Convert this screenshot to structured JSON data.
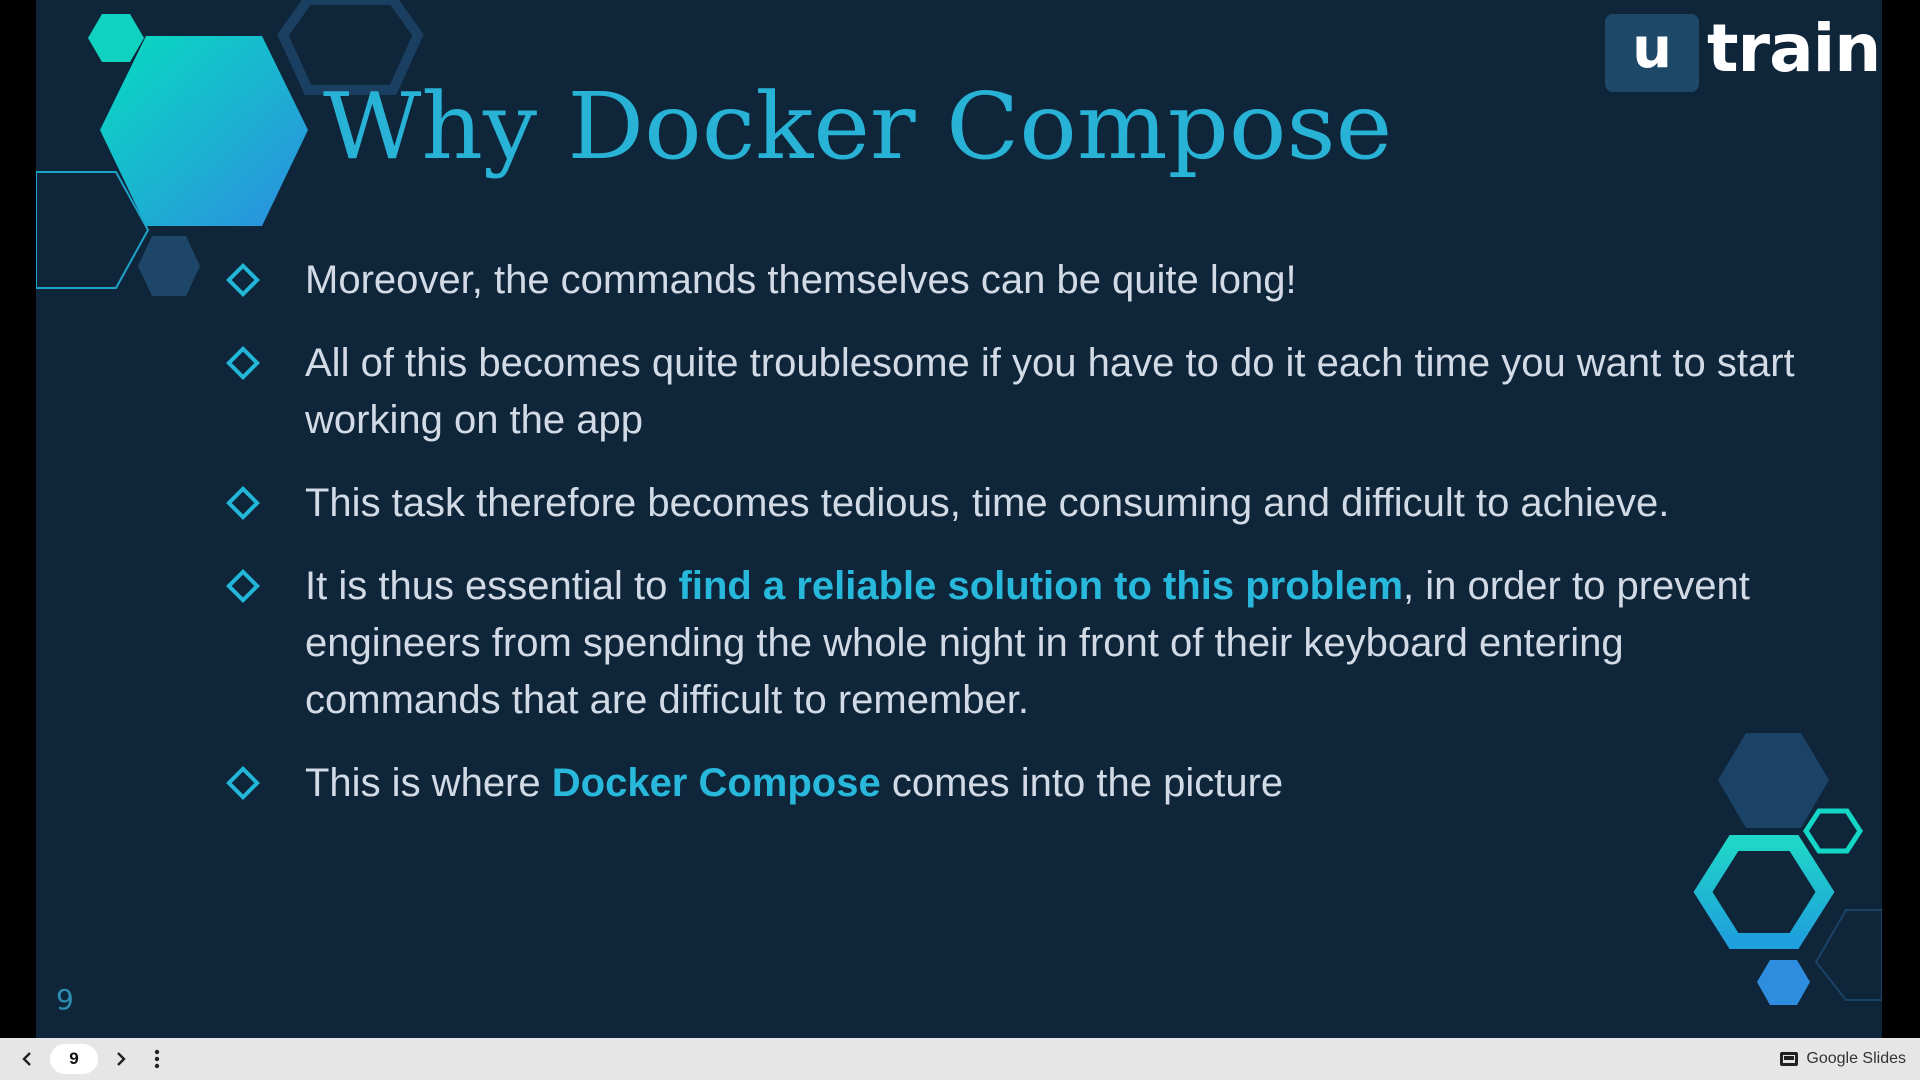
{
  "slide": {
    "logo": {
      "mark": "u",
      "word": "train"
    },
    "title": "Why Docker Compose",
    "bullets": [
      [
        {
          "text": "Moreover, the commands themselves can be quite long!",
          "highlight": false
        }
      ],
      [
        {
          "text": "All of this becomes quite troublesome if you have to do it each time you want to start working on the app",
          "highlight": false
        }
      ],
      [
        {
          "text": "This task therefore becomes tedious, time consuming and difficult to achieve.",
          "highlight": false
        }
      ],
      [
        {
          "text": "It is thus essential to ",
          "highlight": false
        },
        {
          "text": "find a reliable solution to this problem",
          "highlight": true
        },
        {
          "text": ", in order to prevent engineers from spending the whole night in front of their keyboard entering commands that are difficult to remember.",
          "highlight": false
        }
      ],
      [
        {
          "text": "This is where ",
          "highlight": false
        },
        {
          "text": "Docker Compose",
          "highlight": true
        },
        {
          "text": " comes into the picture",
          "highlight": false
        }
      ]
    ],
    "page_number": "9"
  },
  "toolbar": {
    "prev_icon": "chevron-left-icon",
    "next_icon": "chevron-right-icon",
    "menu_icon": "more-vert-icon",
    "current_page": "9",
    "branding_label": "Google Slides",
    "branding_icon": "slides-icon"
  },
  "colors": {
    "background": "#0f253a",
    "accent": "#27b2d6",
    "text": "#d2dbe5",
    "hex_teal": "#0fd2c0",
    "hex_dark": "#1b4368"
  }
}
